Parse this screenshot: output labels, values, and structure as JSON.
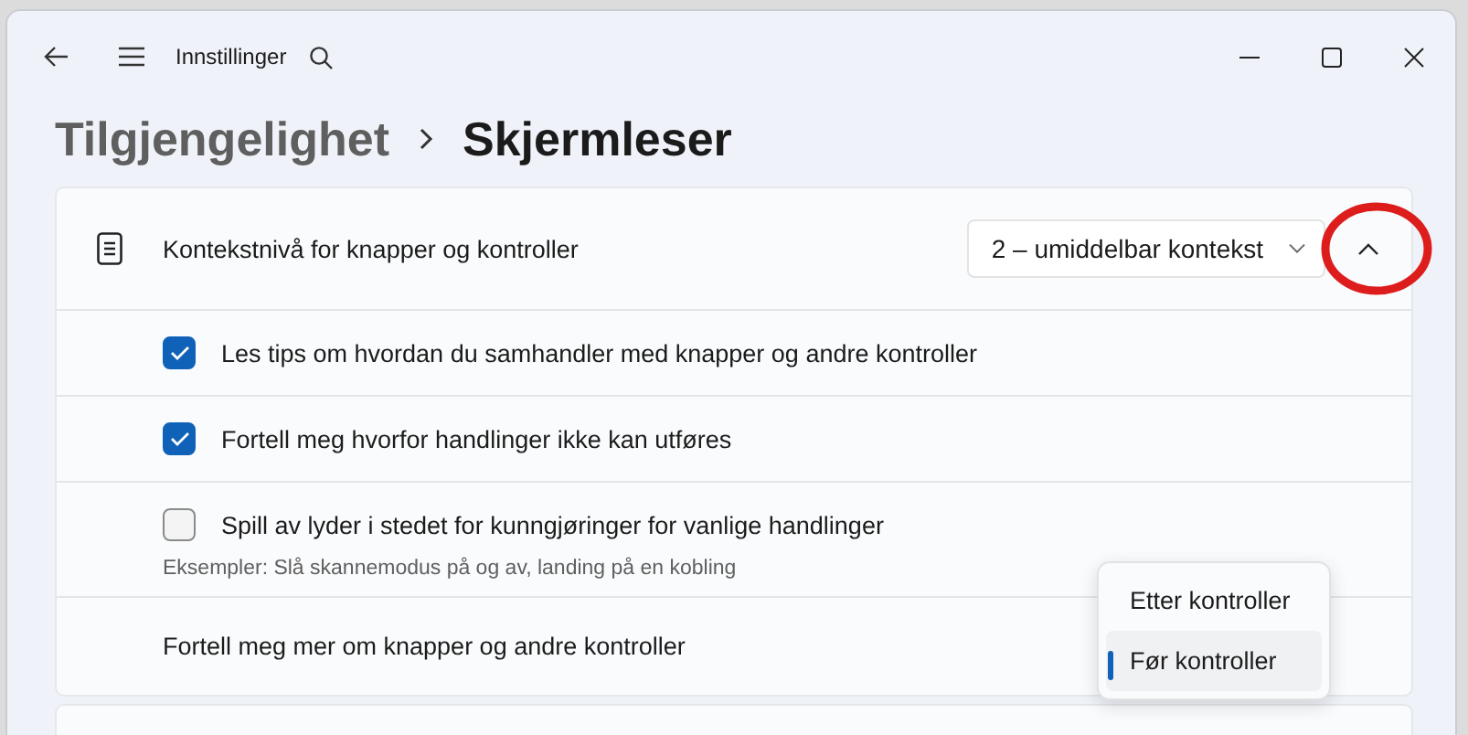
{
  "window": {
    "title": "Innstillinger"
  },
  "breadcrumb": {
    "parent": "Tilgjengelighet",
    "current": "Skjermleser"
  },
  "setting": {
    "label": "Kontekstnivå for knapper og kontroller",
    "value": "2 – umiddelbar kontekst",
    "expanded": true
  },
  "options": [
    {
      "label": "Les tips om hvordan du samhandler med knapper og andre kontroller",
      "checked": true
    },
    {
      "label": "Fortell meg hvorfor handlinger ikke kan utføres",
      "checked": true
    },
    {
      "label": "Spill av lyder i stedet for kunngjøringer for vanlige handlinger",
      "checked": false,
      "description": "Eksempler: Slå skannemodus på og av, landing på en kobling"
    }
  ],
  "more_row": {
    "label": "Fortell meg mer om knapper og andre kontroller"
  },
  "menu": {
    "items": [
      {
        "label": "Etter kontroller",
        "selected": false
      },
      {
        "label": "Før kontroller",
        "selected": true
      }
    ]
  }
}
